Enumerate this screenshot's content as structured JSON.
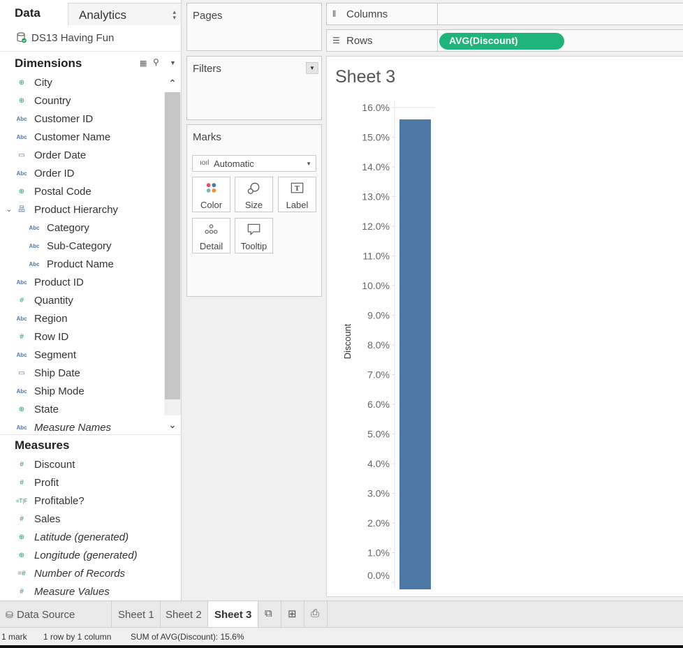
{
  "pane_tabs": {
    "data": "Data",
    "analytics": "Analytics"
  },
  "datasource": "DS13 Having Fun",
  "dimensions": {
    "title": "Dimensions",
    "items": [
      {
        "label": "City",
        "type": "geo",
        "indent": 0
      },
      {
        "label": "Country",
        "type": "geo",
        "indent": 0
      },
      {
        "label": "Customer ID",
        "type": "abc",
        "indent": 0
      },
      {
        "label": "Customer Name",
        "type": "abc",
        "indent": 0
      },
      {
        "label": "Order Date",
        "type": "date",
        "indent": 0
      },
      {
        "label": "Order ID",
        "type": "abc",
        "indent": 0
      },
      {
        "label": "Postal Code",
        "type": "geo",
        "indent": 0
      },
      {
        "label": "Product Hierarchy",
        "type": "hierarchy",
        "indent": 0
      },
      {
        "label": "Category",
        "type": "abc",
        "indent": 1
      },
      {
        "label": "Sub-Category",
        "type": "abc",
        "indent": 1
      },
      {
        "label": "Product Name",
        "type": "abc",
        "indent": 1
      },
      {
        "label": "Product ID",
        "type": "abc",
        "indent": 0
      },
      {
        "label": "Quantity",
        "type": "num",
        "indent": 0
      },
      {
        "label": "Region",
        "type": "abc",
        "indent": 0
      },
      {
        "label": "Row ID",
        "type": "num",
        "indent": 0
      },
      {
        "label": "Segment",
        "type": "abc",
        "indent": 0
      },
      {
        "label": "Ship Date",
        "type": "date",
        "indent": 0
      },
      {
        "label": "Ship Mode",
        "type": "abc",
        "indent": 0
      },
      {
        "label": "State",
        "type": "geo",
        "indent": 0
      },
      {
        "label": "Measure Names",
        "type": "abc",
        "indent": 0,
        "italic": true
      }
    ]
  },
  "measures": {
    "title": "Measures",
    "items": [
      {
        "label": "Discount",
        "type": "mnum"
      },
      {
        "label": "Profit",
        "type": "mnum"
      },
      {
        "label": "Profitable?",
        "type": "bool"
      },
      {
        "label": "Sales",
        "type": "mnum"
      },
      {
        "label": "Latitude (generated)",
        "type": "mgeo",
        "italic": true
      },
      {
        "label": "Longitude (generated)",
        "type": "mgeo",
        "italic": true
      },
      {
        "label": "Number of Records",
        "type": "mcount",
        "italic": true
      },
      {
        "label": "Measure Values",
        "type": "mnum",
        "italic": true
      }
    ]
  },
  "icons": {
    "geo": "globe-icon",
    "abc": "abc-string-icon",
    "date": "calendar-icon",
    "hierarchy": "hierarchy-icon",
    "num": "number-icon",
    "bool": "boolean-icon"
  },
  "shelves": {
    "pages": "Pages",
    "filters": "Filters",
    "marks": "Marks",
    "columns": "Columns",
    "rows": "Rows",
    "rows_pill": "AVG(Discount)"
  },
  "marks": {
    "type": "Automatic",
    "buttons": [
      "Color",
      "Size",
      "Label",
      "Detail",
      "Tooltip"
    ]
  },
  "view": {
    "sheet_title": "Sheet 3"
  },
  "chart_data": {
    "type": "bar",
    "categories": [
      ""
    ],
    "values": [
      0.156
    ],
    "title": "Sheet 3",
    "xlabel": "",
    "ylabel": "Discount",
    "ylim": [
      0,
      0.16
    ],
    "ytick_labels": [
      "0.0%",
      "1.0%",
      "2.0%",
      "3.0%",
      "4.0%",
      "5.0%",
      "6.0%",
      "7.0%",
      "8.0%",
      "9.0%",
      "10.0%",
      "11.0%",
      "12.0%",
      "13.0%",
      "14.0%",
      "15.0%",
      "16.0%"
    ],
    "bar_color": "#4e79a7",
    "grid": false
  },
  "tabs": {
    "datasource": "Data Source",
    "sheets": [
      "Sheet 1",
      "Sheet 2",
      "Sheet 3"
    ],
    "active": "Sheet 3"
  },
  "status": {
    "marks": "1 mark",
    "rows_cols": "1 row by 1 column",
    "sum": "SUM of AVG(Discount): 15.6%"
  },
  "colors": {
    "pill": "#1fb57a",
    "bar": "#4e79a7",
    "geo_icon": "#1f9b5e"
  }
}
